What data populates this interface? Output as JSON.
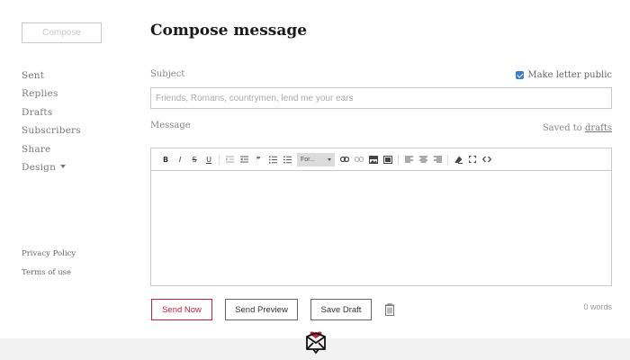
{
  "sidebar": {
    "compose_label": "Compose",
    "nav": [
      {
        "label": "Sent"
      },
      {
        "label": "Replies"
      },
      {
        "label": "Drafts"
      },
      {
        "label": "Subscribers"
      },
      {
        "label": "Share"
      },
      {
        "label": "Design"
      }
    ],
    "legal": [
      {
        "label": "Privacy Policy"
      },
      {
        "label": "Terms of use"
      }
    ]
  },
  "main": {
    "title": "Compose message",
    "subject_label": "Subject",
    "public_label": "Make letter public",
    "public_checked": true,
    "subject_value": "",
    "subject_placeholder": "Friends, Romans, countrymen, lend me your ears",
    "message_label": "Message",
    "saved_prefix": "Saved to",
    "saved_link": "drafts",
    "format_label": "For...",
    "word_count": "0 words"
  },
  "toolbar": {
    "bold": "B",
    "italic": "I",
    "strike": "S",
    "underline": "U",
    "quote": "”"
  },
  "actions": {
    "send_now": "Send Now",
    "send_preview": "Send Preview",
    "save_draft": "Save Draft"
  },
  "icons": {
    "trash": "trash-icon",
    "logo": "envelope-heart-logo"
  },
  "colors": {
    "accent_red": "#c0233a",
    "checkbox_blue": "#3d7cc9"
  }
}
